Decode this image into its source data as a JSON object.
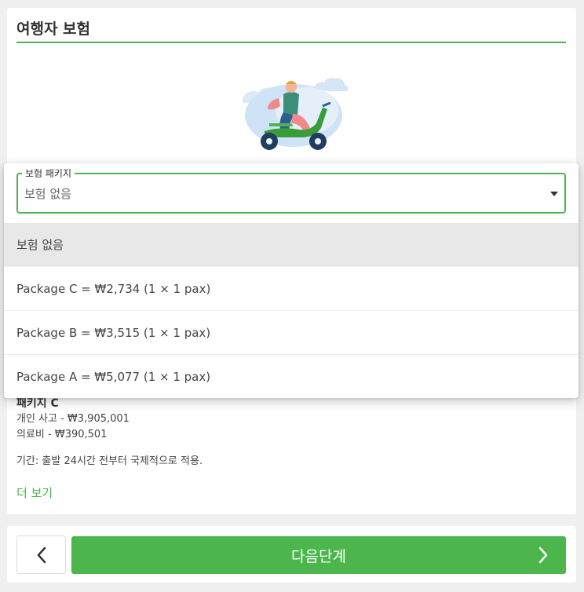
{
  "section": {
    "title": "여행자 보험"
  },
  "insurance_select": {
    "legend": "보험 패키지",
    "value": "보험 없음",
    "options": [
      {
        "label": "보험 없음",
        "selected": true
      },
      {
        "label": "Package C = ₩2,734 (1 × 1 pax)",
        "selected": false
      },
      {
        "label": "Package B = ₩3,515 (1 × 1 pax)",
        "selected": false
      },
      {
        "label": "Package A = ₩5,077 (1 × 1 pax)",
        "selected": false
      }
    ]
  },
  "details": {
    "package_name": "패키지 C",
    "accident": "개인 사고 - ₩3,905,001",
    "medical": "의료비 - ₩390,501",
    "coverage_note": "기간: 출발 24시간 전부터 국제적으로 적용.",
    "more_link": "더 보기"
  },
  "footer": {
    "next_label": "다음단계"
  },
  "colors": {
    "accent": "#4cb64c",
    "selected_option_bg": "#e8e8e8"
  },
  "icons": {
    "illustration": "scooter-rider-illustration",
    "back": "chevron-left-icon",
    "next": "chevron-right-icon",
    "select": "caret-down-icon"
  }
}
